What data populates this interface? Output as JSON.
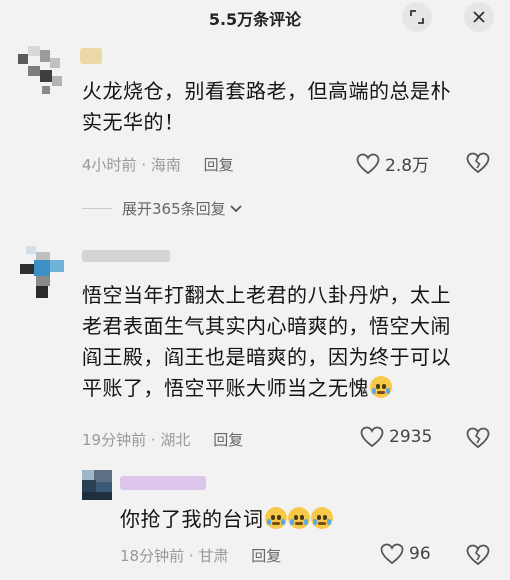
{
  "header": {
    "title": "5.5万条评论"
  },
  "comments": [
    {
      "text_lines": [
        "火龙烧仓，别看套路老，但高端的总是朴",
        "实无华的！"
      ],
      "time": "4小时前",
      "location": "海南",
      "reply_label": "回复",
      "likes": "2.8万",
      "expand_label": "展开365条回复"
    },
    {
      "text_lines": [
        "悟空当年打翻太上老君的八卦丹炉，太上",
        "老君表面生气其实内心暗爽的，悟空大闹",
        "阎王殿，阎王也是暗爽的，因为终于可以",
        "平账了，悟空平账大师当之无愧"
      ],
      "time": "19分钟前",
      "location": "湖北",
      "reply_label": "回复",
      "likes": "2935"
    }
  ],
  "reply": {
    "text": "你抢了我的台词",
    "time": "18分钟前",
    "location": "甘肃",
    "reply_label": "回复",
    "likes": "96"
  },
  "icons": {
    "header_left": "expand-icon",
    "header_right": "close-icon",
    "like": "heart-outline-icon",
    "dislike": "broken-heart-icon",
    "expand_chevron": "chevron-down-icon",
    "emoji": "crying-laughing-emoji"
  },
  "colors": {
    "background": "#f2f2f2",
    "meta_text": "#999999"
  }
}
